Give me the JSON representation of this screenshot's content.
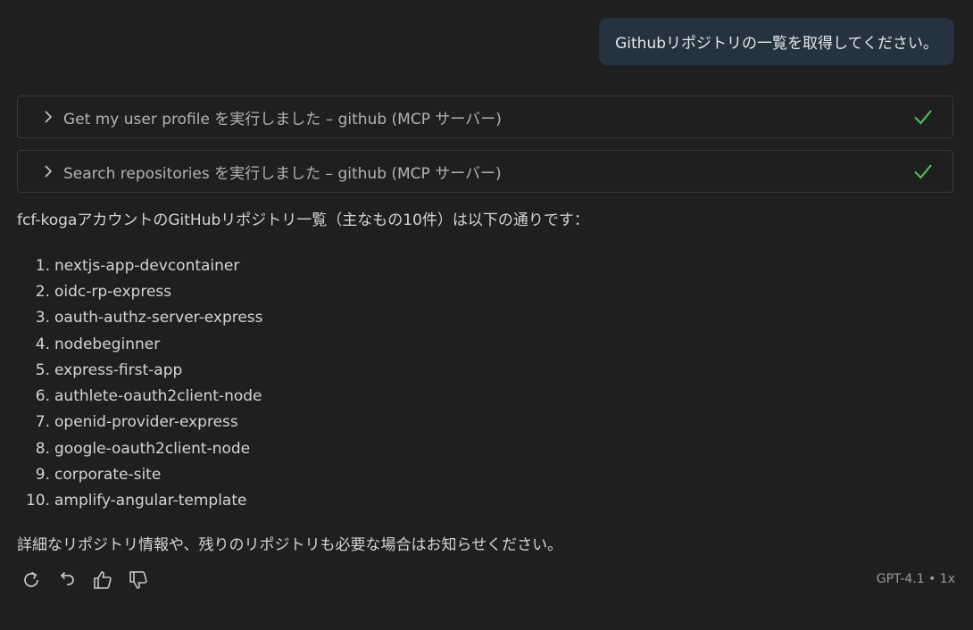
{
  "user_message": "Githubリポジトリの一覧を取得してください。",
  "tool_calls": [
    {
      "label": "Get my user profile を実行しました – github (MCP サーバー)",
      "status_icon": "check-icon",
      "status_color": "#4ec45e"
    },
    {
      "label": "Search repositories を実行しました – github (MCP サーバー)",
      "status_icon": "check-icon",
      "status_color": "#4ec45e"
    }
  ],
  "response": {
    "intro": "fcf-kogaアカウントのGitHubリポジトリ一覧（主なもの10件）は以下の通りです：",
    "repositories": [
      {
        "num": "1.",
        "name": "nextjs-app-devcontainer"
      },
      {
        "num": "2.",
        "name": "oidc-rp-express"
      },
      {
        "num": "3.",
        "name": "oauth-authz-server-express"
      },
      {
        "num": "4.",
        "name": "nodebeginner"
      },
      {
        "num": "5.",
        "name": "express-first-app"
      },
      {
        "num": "6.",
        "name": "authlete-oauth2client-node"
      },
      {
        "num": "7.",
        "name": "openid-provider-express"
      },
      {
        "num": "8.",
        "name": "google-oauth2client-node"
      },
      {
        "num": "9.",
        "name": "corporate-site"
      },
      {
        "num": "10.",
        "name": "amplify-angular-template"
      }
    ],
    "outro": "詳細なリポジトリ情報や、残りのリポジトリも必要な場合はお知らせください。"
  },
  "actions": [
    "retry-icon",
    "undo-icon",
    "thumbs-up-icon",
    "thumbs-down-icon"
  ],
  "model_label": "GPT-4.1 • 1x",
  "colors": {
    "background": "#1f1f1f",
    "user_bubble": "#253341",
    "success": "#4ec45e"
  }
}
